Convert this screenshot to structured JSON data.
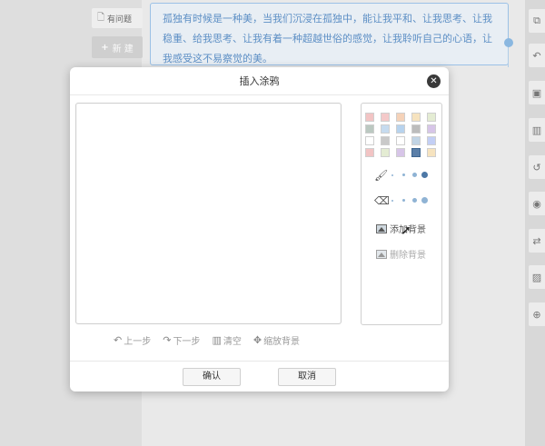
{
  "background": {
    "tag_button_label": "有问题",
    "new_button_label": "新 建",
    "text_card": "孤独有时候是一种美，当我们沉浸在孤独中，能让我平和、让我思考、让我稳重、给我思考、让我有着一种超越世俗的感觉，让我聆听自己的心语，让我感受这不易察觉的美。",
    "right_toolbar_icons": [
      "copy-icon",
      "undo-icon",
      "save-icon",
      "trash-icon",
      "history-icon",
      "eye-icon",
      "swap-icon",
      "image-icon",
      "zoom-icon"
    ]
  },
  "dialog": {
    "title": "插入涂鸦",
    "close_icon": "close-icon",
    "palette": [
      "#f2c4c4",
      "#f4c9c9",
      "#f5d2b8",
      "#f6e3bf",
      "#e4ecd3",
      "#bbc8c1",
      "#c6dbef",
      "#b7d3ee",
      "#bcbcbc",
      "#d7c5e8",
      "#ffffff",
      "#c9c9c9",
      "#ffffff",
      "#c1d4e5",
      "#c3cff5",
      "#f2c4c4",
      "#e4ecd3",
      "#d7c5e8",
      "#5b7fa8",
      "#f6e3bf"
    ],
    "selected_color": "#5b7fa8",
    "tools": {
      "brush_icon": "brush-icon",
      "eraser_icon": "eraser-icon",
      "add_background": "添加背景",
      "remove_background": "删除背景"
    },
    "actions": {
      "undo": "上一步",
      "redo": "下一步",
      "clear": "清空",
      "scale_background": "缩放背景"
    },
    "buttons": {
      "confirm": "确认",
      "cancel": "取消"
    }
  }
}
